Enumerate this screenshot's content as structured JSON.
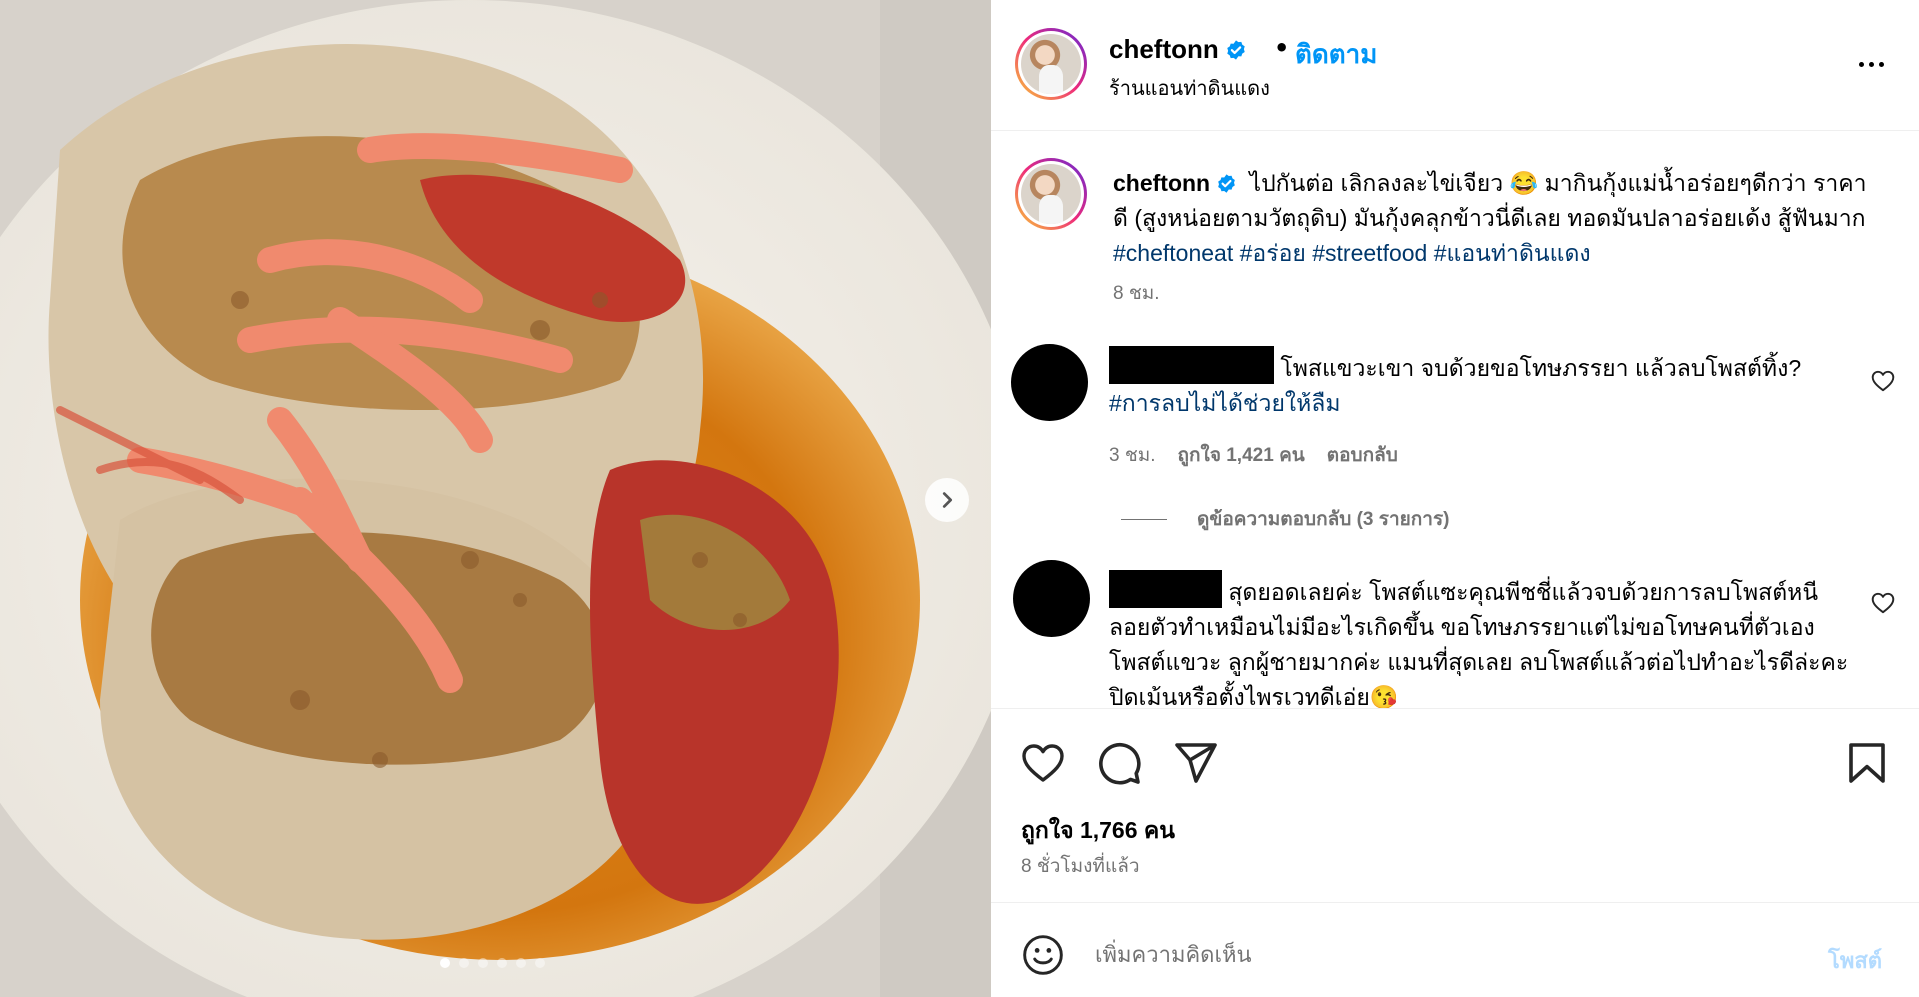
{
  "post": {
    "username": "cheftonn",
    "follow_label": "ติดตาม",
    "separator": "•",
    "location": "ร้านแอนท่าดินแดง",
    "image_count": 6,
    "image_active_index": 0
  },
  "caption": {
    "username": "cheftonn",
    "text_1": "ไปกันต่อ เลิกลงละไข่เจียว",
    "emoji_1": "😂",
    "text_2": "มากินกุ้งแม่น้ำอร่อยๆดีกว่า ราคาดี (สูงหน่อยตามวัตถุดิบ) มันกุ้งคลุกข้าวนี่ดีเลย ทอดมันปลาอร่อยเด้ง สู้ฟันมาก",
    "hashtags": [
      "#cheftoneat",
      "#อร่อย",
      "#streetfood",
      "#แอนท่าดินแดง"
    ],
    "time": "8 ชม."
  },
  "comments": [
    {
      "text": "โพสแขวะเขา จบด้วยขอโทษภรรยา แล้วลบโพสต์ทิ้ง?",
      "hashtag": "#การลบไม่ได้ช่วยให้ลืม",
      "time": "3 ชม.",
      "likes": "ถูกใจ 1,421 คน",
      "reply_label": "ตอบกลับ",
      "view_replies": "ดูข้อความตอบกลับ (3 รายการ)"
    },
    {
      "text": "สุดยอดเลยค่ะ โพสต์แซะคุณพีชชี่แล้วจบด้วยการลบโพสต์หนี ลอยตัวทำเหมือนไม่มีอะไรเกิดขึ้น ขอโทษภรรยาแต่ไม่ขอโทษคนที่ตัวเองโพสต์แขวะ ลูกผู้ชายมากค่ะ แมนที่สุดเลย ลบโพสต์แล้วต่อไปทำอะไรดีล่ะคะ ปิดเม้นหรือตั้งไพรเวทดีเอ่ย",
      "emoji": "😘"
    }
  ],
  "footer": {
    "likes": "ถูกใจ 1,766 คน",
    "ago": "8 ชั่วโมงที่แล้ว"
  },
  "composer": {
    "placeholder": "เพิ่มความคิดเห็น",
    "post_label": "โพสต์"
  },
  "colors": {
    "link": "#0095f6",
    "hashtag": "#00376b",
    "muted": "#737373",
    "post_disabled": "#b3dbff"
  },
  "icons": [
    "chevron-right-icon",
    "verified-badge-icon",
    "more-options-icon",
    "heart-icon",
    "comment-icon",
    "share-icon",
    "bookmark-icon",
    "emoji-icon"
  ]
}
